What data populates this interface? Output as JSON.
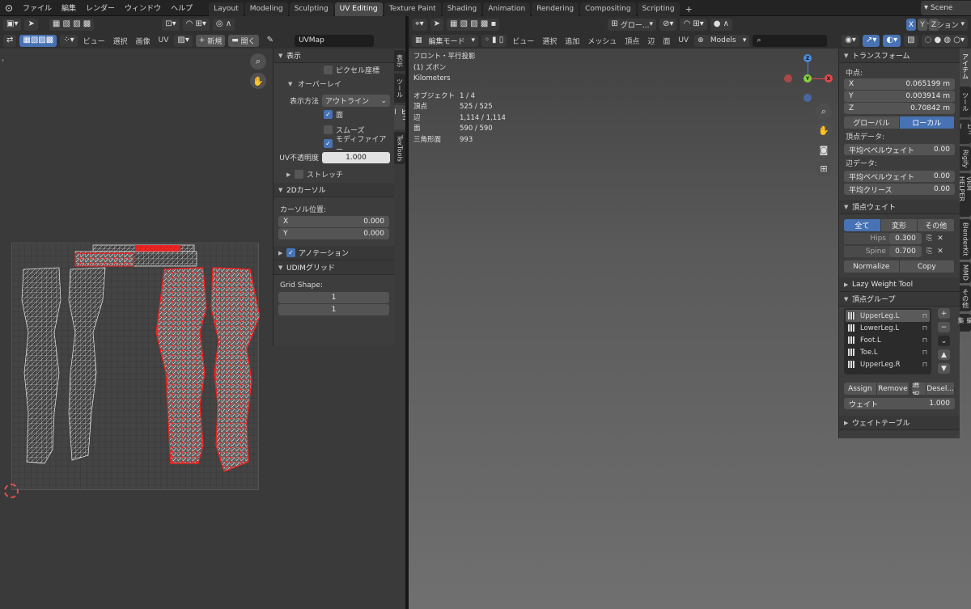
{
  "topbar": {
    "menus": [
      "ファイル",
      "編集",
      "レンダー",
      "ウィンドウ",
      "ヘルプ"
    ],
    "tabs": [
      "Layout",
      "Modeling",
      "Sculpting",
      "UV Editing",
      "Texture Paint",
      "Shading",
      "Animation",
      "Rendering",
      "Compositing",
      "Scripting"
    ],
    "active_tab": "UV Editing",
    "scene_label": "Scene"
  },
  "uv_editor": {
    "menus": [
      "ビュー",
      "選択",
      "画像",
      "UV"
    ],
    "new_label": "新規",
    "open_label": "開く",
    "uvmap_name": "UVMap",
    "side_tabs": [
      "表示",
      "ツール",
      "ビュー",
      "TexTools"
    ],
    "panel": {
      "display_title": "表示",
      "pixel_coords": "ピクセル座標",
      "overlay_title": "オーバーレイ",
      "display_method_label": "表示方法",
      "display_method_value": "アウトライン",
      "faces_label": "面",
      "smooth_label": "スムーズ",
      "modifier_label": "モディファイアー",
      "uv_opacity_label": "UV不透明度",
      "uv_opacity_value": "1.000",
      "stretch_label": "ストレッチ",
      "cursor_title": "2Dカーソル",
      "cursor_pos_label": "カーソル位置:",
      "cursor_x_label": "X",
      "cursor_x": "0.000",
      "cursor_y_label": "Y",
      "cursor_y": "0.000",
      "annotation_label": "アノテーション",
      "udim_title": "UDIMグリッド",
      "grid_shape_label": "Grid Shape:",
      "grid_shape_x": "1",
      "grid_shape_y": "1"
    }
  },
  "viewport": {
    "mode_label": "編集モード",
    "menus": [
      "ビュー",
      "選択",
      "追加",
      "メッシュ",
      "頂点",
      "辺",
      "面",
      "UV"
    ],
    "transform_orientation": "グロー...",
    "options_label": "オプション",
    "collection": "Models",
    "info": {
      "view_name": "フロント・平行投影",
      "object_name": "(1) ズボン",
      "units": "Kilometers",
      "stats": [
        {
          "label": "オブジェクト",
          "value": "1 / 4"
        },
        {
          "label": "頂点",
          "value": "525 / 525"
        },
        {
          "label": "辺",
          "value": "1,114 / 1,114"
        },
        {
          "label": "面",
          "value": "590 / 590"
        },
        {
          "label": "三角形面",
          "value": "993"
        }
      ]
    },
    "gizmo": {
      "x": "X",
      "y": "Y",
      "z": "Z"
    }
  },
  "right_panel": {
    "transform_title": "トランスフォーム",
    "median_label": "中点:",
    "x_label": "X",
    "x_value": "0.065199 m",
    "y_label": "Y",
    "y_value": "0.003914 m",
    "z_label": "Z",
    "z_value": "0.70842 m",
    "global_label": "グローバル",
    "local_label": "ローカル",
    "vertex_data_label": "頂点データ:",
    "vertex_bevel_label": "平均ベベルウェイト",
    "vertex_bevel_value": "0.00",
    "edge_data_label": "辺データ:",
    "edge_bevel_label": "平均ベベルウェイト",
    "edge_bevel_value": "0.00",
    "edge_crease_label": "平均クリース",
    "edge_crease_value": "0.00",
    "vertex_weights_title": "頂点ウェイト",
    "vw_tabs": [
      "全て",
      "変形",
      "その他"
    ],
    "weights": [
      {
        "name": "Hips",
        "value": "0.300"
      },
      {
        "name": "Spine",
        "value": "0.700"
      }
    ],
    "normalize_label": "Normalize",
    "copy_label": "Copy",
    "lazy_weight_label": "Lazy Weight Tool",
    "vertex_groups_title": "頂点グループ",
    "groups": [
      "UpperLeg.L",
      "LowerLeg.L",
      "Foot.L",
      "Toe.L",
      "UpperLeg.R"
    ],
    "assign_label": "Assign",
    "remove_label": "Remove",
    "select_label": "選択",
    "deselect_label": "Desel...",
    "weight_label": "ウェイト",
    "weight_value": "1.000",
    "weight_table_label": "ウェイトテーブル",
    "side_tabs": [
      "アイテム",
      "ツール",
      "ビュー",
      "Rigify",
      "VRM HELPER",
      "BlenderKit",
      "MMD",
      "その他",
      "編集"
    ]
  }
}
